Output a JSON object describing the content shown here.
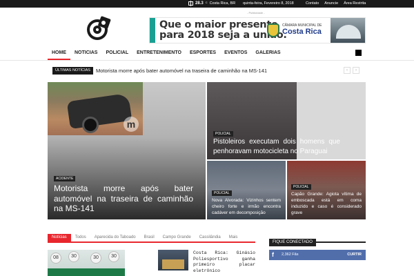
{
  "topbar": {
    "temperature": "28.3",
    "degree": "C",
    "location": "Costa Rica, BR",
    "date": "quinta-feira, Fevereiro 8, 2018",
    "links": [
      "Contato",
      "Anuncie",
      "Área Restrita"
    ]
  },
  "ad": {
    "label": "- Publicidade -",
    "slogan_line1": "Que o maior presente",
    "slogan_line2": "para 2018 seja a união.",
    "org_label": "CÂMARA MUNICIPAL DE",
    "org_name": "Costa Rica"
  },
  "nav": {
    "items": [
      "HOME",
      "NOTICIAS",
      "POLICIAL",
      "ENTRETENIMENTO",
      "ESPORTES",
      "EVENTOS",
      "GALERIAS"
    ]
  },
  "ticker": {
    "label": "ÚLTIMAS NOTÍCIAS",
    "text": "Motorista morre após bater automóvel na traseira de caminhão na MS-141",
    "prev": "‹",
    "next": "›"
  },
  "featured": {
    "main": {
      "category": "ACIDENTE",
      "title": "Motorista morre após bater automóvel na traseira de caminhão na MS-141",
      "watermark": "m"
    },
    "top_right": {
      "category": "POLICIAL",
      "title": "Pistoleiros executam dois homens que penhoravam motocicleta no Paraguai"
    },
    "bottom_left": {
      "category": "POLICIAL",
      "title": "Nova Alvorada: Vizinhos sentem cheiro forte e irmão encontra cadáver em decomposição"
    },
    "bottom_right": {
      "category": "POLICIAL",
      "title": "Capão Grande: Agiota vítima de emboscada está em coma induzido e caso é considerado grave"
    }
  },
  "tabs": [
    "Notícias",
    "Todos",
    "Aparecida do Taboado",
    "Brasil",
    "Campo Grande",
    "Cassilândia",
    "Mais"
  ],
  "news_list": {
    "side_title": "Costa Rica: Ginásio Poliesportivo ganha primeiro placar eletrônico",
    "balls": [
      "08",
      "30",
      "30",
      "30"
    ]
  },
  "widget": {
    "title": "FIQUE CONECTADO",
    "facebook": {
      "icon": "f",
      "count": "2,362",
      "unit": "Fãs",
      "cta": "CURTIR"
    }
  },
  "colors": {
    "accent": "#e8262d",
    "dark": "#1a1a1a",
    "facebook": "#516eab"
  }
}
